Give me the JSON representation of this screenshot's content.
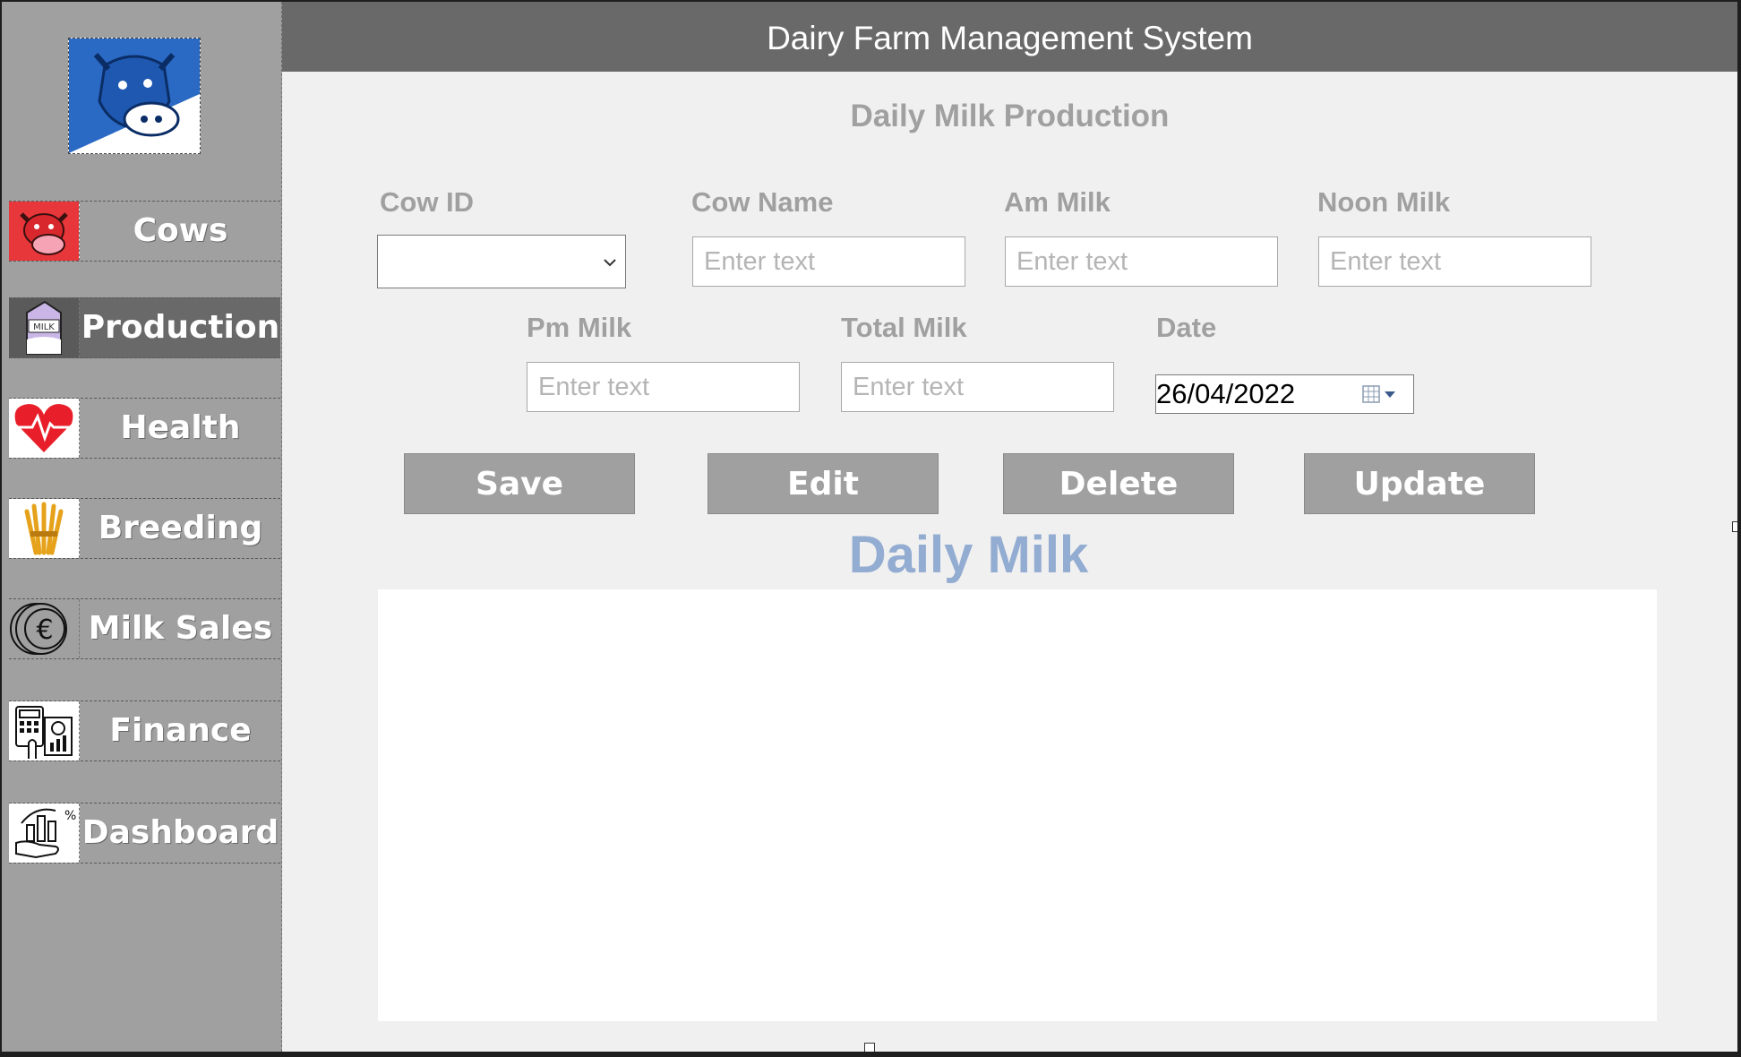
{
  "app": {
    "title": "Dairy Farm Management System"
  },
  "sidebar": {
    "items": [
      {
        "label": "Cows",
        "icon": "cow-icon"
      },
      {
        "label": "Production",
        "icon": "milk-carton-icon",
        "active": true
      },
      {
        "label": "Health",
        "icon": "heartbeat-icon"
      },
      {
        "label": "Breeding",
        "icon": "wheat-icon"
      },
      {
        "label": "Milk Sales",
        "icon": "euro-coins-icon"
      },
      {
        "label": "Finance",
        "icon": "calculator-chart-icon"
      },
      {
        "label": "Dashboard",
        "icon": "dashboard-chart-icon"
      }
    ]
  },
  "form": {
    "section_title": "Daily Milk Production",
    "labels": {
      "cow_id": "Cow ID",
      "cow_name": "Cow Name",
      "am_milk": "Am Milk",
      "noon_milk": "Noon Milk",
      "pm_milk": "Pm Milk",
      "total_milk": "Total Milk",
      "date": "Date"
    },
    "placeholder": "Enter text",
    "cow_id_value": "",
    "date_value": "26/04/2022"
  },
  "buttons": {
    "save": "Save",
    "edit": "Edit",
    "delete": "Delete",
    "update": "Update"
  },
  "grid": {
    "title": "Daily Milk"
  },
  "colors": {
    "sidebar": "#a0a0a0",
    "header": "#696969",
    "label": "#a0a0a0",
    "grid_title": "#93acd1",
    "button": "#a0a0a0"
  }
}
